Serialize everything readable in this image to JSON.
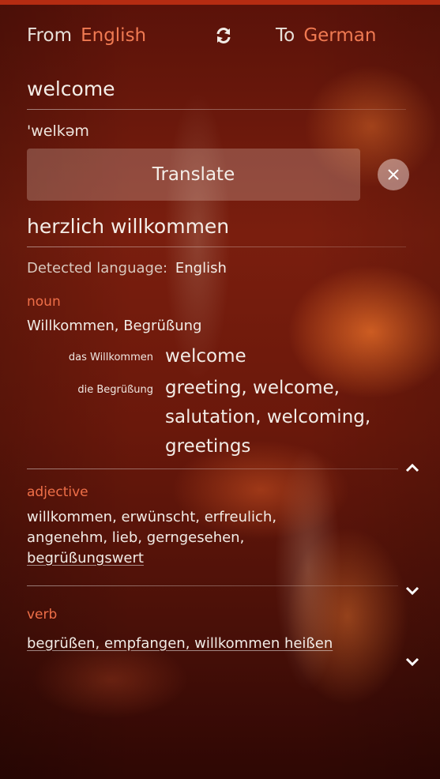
{
  "header": {
    "from_label": "From",
    "from_value": "English",
    "to_label": "To",
    "to_value": "German",
    "swap_icon": "swap-icon"
  },
  "input": {
    "text": "welcome",
    "phonetic": "'welkəm"
  },
  "actions": {
    "translate_label": "Translate",
    "clear_icon": "close-icon"
  },
  "result": {
    "text": "herzlich willkommen",
    "detected_label": "Detected language:",
    "detected_value": "English"
  },
  "dictionary": {
    "noun": {
      "pos": "noun",
      "synonyms": "Willkommen, Begrüßung",
      "entries": [
        {
          "word": "das Willkommen",
          "translations": [
            "welcome"
          ]
        },
        {
          "word": "die Begrüßung",
          "translations": [
            "greeting, welcome,",
            "salutation, welcoming,",
            "greetings"
          ]
        }
      ]
    },
    "adjective": {
      "pos": "adjective",
      "lines": [
        "willkommen, erwünscht, erfreulich,",
        "angenehm, lieb, gerngesehen,",
        "begrüßungswert"
      ]
    },
    "verb": {
      "pos": "verb",
      "line": "begrüßen, empfangen, willkommen heißen"
    }
  },
  "colors": {
    "accent": "#f07a52",
    "pos_color": "#ef6f48"
  }
}
